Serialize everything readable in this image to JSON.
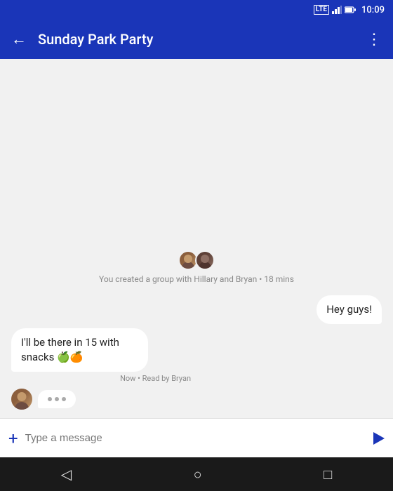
{
  "statusBar": {
    "time": "10:09",
    "icons": [
      "LTE",
      "signal",
      "battery"
    ]
  },
  "appBar": {
    "back_label": "←",
    "title": "Sunday Park Party",
    "more_label": "⋮"
  },
  "groupNotice": {
    "text": "You created a group with Hillary and Bryan • 18 mins"
  },
  "messages": [
    {
      "id": "msg1",
      "type": "sent",
      "text": "Hey guys!",
      "meta": null
    },
    {
      "id": "msg2",
      "type": "received",
      "text": "I'll be there in 15 with snacks 🍏🍊",
      "meta": "Now • Read by Bryan"
    }
  ],
  "typingIndicator": {
    "visible": true
  },
  "inputBar": {
    "placeholder": "Type a message",
    "add_label": "+",
    "send_label": "▶"
  },
  "navBar": {
    "back_label": "◁",
    "home_label": "○",
    "recents_label": "□"
  }
}
